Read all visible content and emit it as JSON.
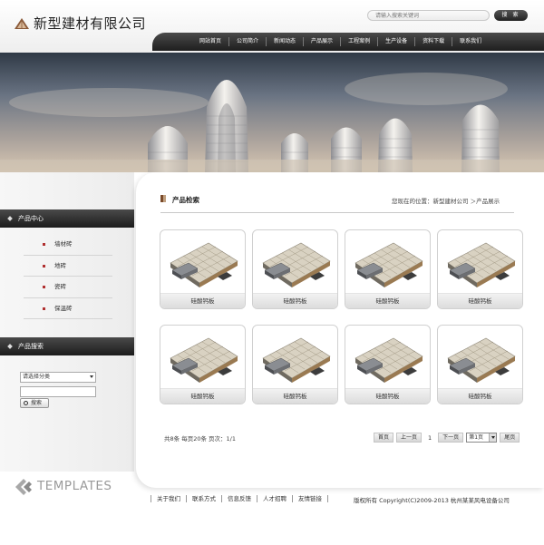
{
  "company_name": "新型建材有限公司",
  "search": {
    "placeholder": "请输入搜索关键词",
    "button": "搜 索"
  },
  "nav": [
    "网站首页",
    "公司简介",
    "新闻动态",
    "产品展示",
    "工程案例",
    "生产设备",
    "资料下载",
    "联系我们"
  ],
  "sidebar": {
    "product_center_title": "产品中心",
    "categories": [
      "墙材砖",
      "地砖",
      "瓷砖",
      "保温砖"
    ],
    "product_search_title": "产品搜索",
    "select_placeholder": "请选择分类",
    "search_button": "搜索"
  },
  "main": {
    "title": "产品检索",
    "breadcrumb": "您现在的位置：新型建材公司 ＞产品展示",
    "products": [
      "硅酸钙板",
      "硅酸钙板",
      "硅酸钙板",
      "硅酸钙板",
      "硅酸钙板",
      "硅酸钙板",
      "硅酸钙板",
      "硅酸钙板"
    ],
    "pager_info": "共8条  每页20条  页次：1/1",
    "pager": {
      "first": "首页",
      "prev": "上一页",
      "current": "1",
      "next": "下一页",
      "select": "第1页",
      "last": "尾页"
    }
  },
  "footer": {
    "logo_text": "TEMPLATES",
    "links": [
      "关于我们",
      "联系方式",
      "信息反馈",
      "人才招聘",
      "友情链接"
    ],
    "copyright": "版权所有  Copyright(C)2009-2013 杭州某某风电设备公司"
  },
  "colors": {
    "nav_dark": "#2a2a2a",
    "accent_brown": "#7a4a2a",
    "bullet_red": "#b03030"
  }
}
